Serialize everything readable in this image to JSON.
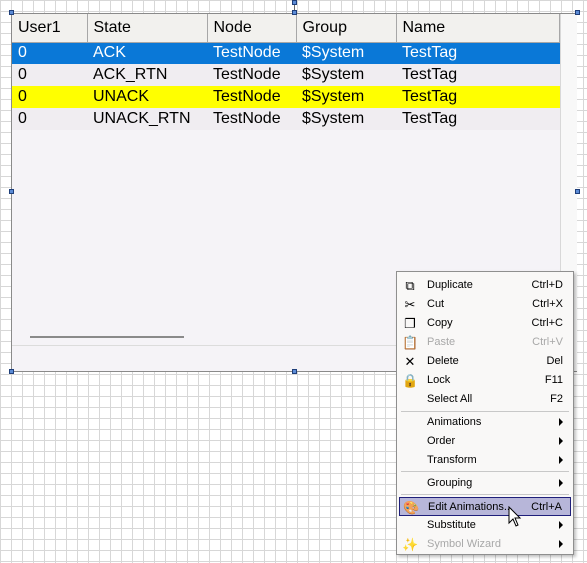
{
  "grid": {
    "columns": [
      "User1",
      "State",
      "Node",
      "Group",
      "Name"
    ],
    "rows": [
      {
        "user": "0",
        "state": "ACK",
        "node": "TestNode",
        "group": "$System",
        "name": "TestTag"
      },
      {
        "user": "0",
        "state": "ACK_RTN",
        "node": "TestNode",
        "group": "$System",
        "name": "TestTag"
      },
      {
        "user": "0",
        "state": "UNACK",
        "node": "TestNode",
        "group": "$System",
        "name": "TestTag"
      },
      {
        "user": "0",
        "state": "UNACK_RTN",
        "node": "TestNode",
        "group": "$System",
        "name": "TestTag"
      }
    ]
  },
  "menu": {
    "duplicate": {
      "label": "Duplicate",
      "shortcut": "Ctrl+D"
    },
    "cut": {
      "label": "Cut",
      "shortcut": "Ctrl+X"
    },
    "copy": {
      "label": "Copy",
      "shortcut": "Ctrl+C"
    },
    "paste": {
      "label": "Paste",
      "shortcut": "Ctrl+V"
    },
    "delete": {
      "label": "Delete",
      "shortcut": "Del"
    },
    "lock": {
      "label": "Lock",
      "shortcut": "F11"
    },
    "select_all": {
      "label": "Select All",
      "shortcut": "F2"
    },
    "animations": {
      "label": "Animations"
    },
    "order": {
      "label": "Order"
    },
    "transform": {
      "label": "Transform"
    },
    "grouping": {
      "label": "Grouping"
    },
    "edit_animations": {
      "label": "Edit Animations...",
      "shortcut": "Ctrl+A"
    },
    "substitute": {
      "label": "Substitute"
    },
    "symbol_wizard": {
      "label": "Symbol Wizard"
    }
  },
  "colors": {
    "ack_row": "#0a78d7",
    "unack_row": "#ffff00",
    "menu_highlight": "#b7b6d9"
  }
}
